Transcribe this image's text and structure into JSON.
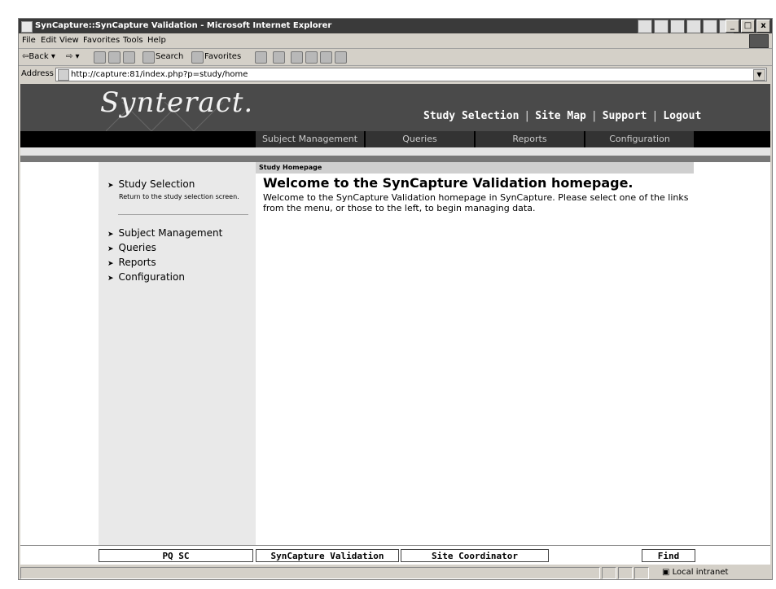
{
  "window": {
    "title": "SynCapture::SynCapture Validation - Microsoft Internet Explorer",
    "controls": [
      "_",
      "□",
      "x"
    ]
  },
  "menu": [
    "File",
    "Edit",
    "View",
    "Favorites",
    "Tools",
    "Help"
  ],
  "toolbar": {
    "back": "⇦Back ▾",
    "forward": "⇨ ▾",
    "search": "Search",
    "favorites": "Favorites"
  },
  "address": {
    "label": "Address",
    "url": "http://capture:81/index.php?p=study/home"
  },
  "site": {
    "logo": "Synteract.",
    "top_links": [
      "Study Selection",
      "Site Map",
      "Support",
      "Logout"
    ],
    "nav_tabs": [
      "Subject Management",
      "Queries",
      "Reports",
      "Configuration"
    ],
    "section_header": "Study Homepage"
  },
  "sidebar": {
    "study_selection": "Study Selection",
    "study_selection_desc": "Return to the study selection screen.",
    "items": [
      "Subject Management",
      "Queries",
      "Reports",
      "Configuration"
    ]
  },
  "main": {
    "heading": "Welcome to the SynCapture Validation homepage.",
    "body": "Welcome to the SynCapture Validation homepage in SynCapture. Please select one of the links from the menu, or those to the left, to begin managing data."
  },
  "footer": {
    "user": "PQ SC",
    "study": "SynCapture Validation",
    "role": "Site Coordinator",
    "find": "Find"
  },
  "status": {
    "zone": "Local intranet"
  }
}
